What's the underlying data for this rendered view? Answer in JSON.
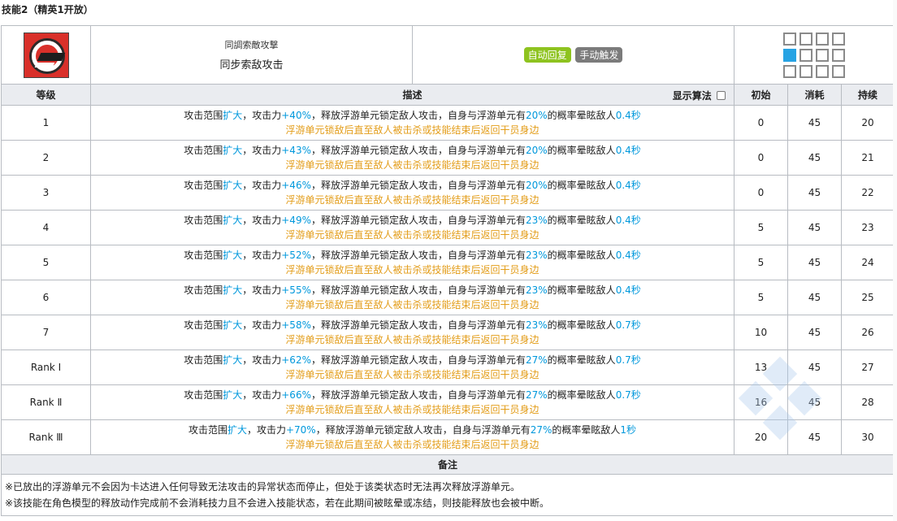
{
  "page_title": "技能2（精英1开放）",
  "skill": {
    "icon_name": "skill-icon",
    "name_original": "同調索敵攻撃",
    "name": "同步索敌攻击",
    "tags": [
      "自动回复",
      "手动触发"
    ]
  },
  "columns": {
    "level": "等级",
    "description": "描述",
    "show_formula": "显示算法",
    "initial": "初始",
    "cost": "消耗",
    "duration": "持续"
  },
  "desc_parts": {
    "a": "攻击范围",
    "b": "扩大",
    "c": "，攻击力",
    "d": "，释放浮游单元锁定敌人攻击，自身与浮游单元有",
    "e": "的概率晕眩敌人",
    "line2": "浮游单元锁敌后直至敌人被击杀或技能结束后返回干员身边"
  },
  "rows": [
    {
      "level": "1",
      "atk": "+40%",
      "prob": "20%",
      "stun": "0.4秒",
      "initial": "0",
      "cost": "45",
      "duration": "20"
    },
    {
      "level": "2",
      "atk": "+43%",
      "prob": "20%",
      "stun": "0.4秒",
      "initial": "0",
      "cost": "45",
      "duration": "21"
    },
    {
      "level": "3",
      "atk": "+46%",
      "prob": "20%",
      "stun": "0.4秒",
      "initial": "0",
      "cost": "45",
      "duration": "22"
    },
    {
      "level": "4",
      "atk": "+49%",
      "prob": "23%",
      "stun": "0.4秒",
      "initial": "5",
      "cost": "45",
      "duration": "23"
    },
    {
      "level": "5",
      "atk": "+52%",
      "prob": "23%",
      "stun": "0.4秒",
      "initial": "5",
      "cost": "45",
      "duration": "24"
    },
    {
      "level": "6",
      "atk": "+55%",
      "prob": "23%",
      "stun": "0.4秒",
      "initial": "5",
      "cost": "45",
      "duration": "25"
    },
    {
      "level": "7",
      "atk": "+58%",
      "prob": "23%",
      "stun": "0.7秒",
      "initial": "10",
      "cost": "45",
      "duration": "26"
    },
    {
      "level": "Rank Ⅰ",
      "atk": "+62%",
      "prob": "27%",
      "stun": "0.7秒",
      "initial": "13",
      "cost": "45",
      "duration": "27"
    },
    {
      "level": "Rank Ⅱ",
      "atk": "+66%",
      "prob": "27%",
      "stun": "0.7秒",
      "initial": "16",
      "cost": "45",
      "duration": "28"
    },
    {
      "level": "Rank Ⅲ",
      "atk": "+70%",
      "prob": "27%",
      "stun": "1秒",
      "initial": "20",
      "cost": "45",
      "duration": "30"
    }
  ],
  "notes": {
    "title": "备注",
    "items": [
      "※已放出的浮游单元不会因为卡达进入任何导致无法攻击的异常状态而停止，但处于该类状态时无法再次释放浮游单元。",
      "※该技能在角色模型的释放动作完成前不会消耗技力且不会进入技能状态，若在此期间被眩晕或冻结，则技能释放也会被中断。"
    ]
  },
  "colors": {
    "accent_blue": "#0098dc",
    "orange_text": "#e39d19",
    "tag_auto": "#8ec31f",
    "tag_manual": "#7b7b7b",
    "header_bg": "#eaecf0",
    "range_self": "#27a3e3"
  }
}
